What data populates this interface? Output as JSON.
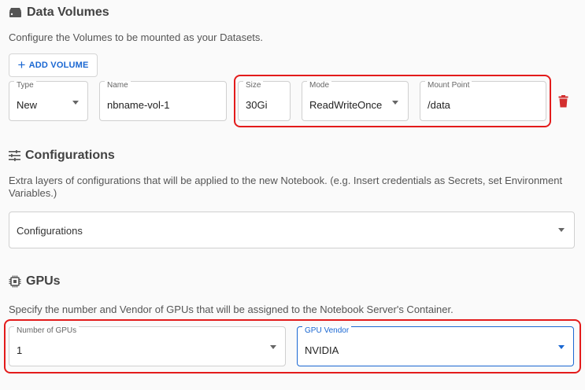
{
  "data_volumes": {
    "title": "Data Volumes",
    "icon": "storage-icon",
    "description": "Configure the Volumes to be mounted as your Datasets.",
    "add_button": {
      "plus": "+",
      "label": "ADD VOLUME"
    },
    "volume": {
      "type": {
        "label": "Type",
        "value": "New"
      },
      "name": {
        "label": "Name",
        "value": "nbname-vol-1"
      },
      "size": {
        "label": "Size",
        "value": "30Gi"
      },
      "mode": {
        "label": "Mode",
        "value": "ReadWriteOnce"
      },
      "mount_point": {
        "label": "Mount Point",
        "value": "/data"
      }
    },
    "delete_icon": "trash-icon"
  },
  "configurations": {
    "title": "Configurations",
    "icon": "tune-icon",
    "description": "Extra layers of configurations that will be applied to the new Notebook. (e.g. Insert credentials as Secrets, set Environment Variables.)",
    "select_placeholder": "Configurations"
  },
  "gpus": {
    "title": "GPUs",
    "icon": "chip-icon",
    "description": "Specify the number and Vendor of GPUs that will be assigned to the Notebook Server's Container.",
    "number": {
      "label": "Number of GPUs",
      "value": "1"
    },
    "vendor": {
      "label": "GPU Vendor",
      "value": "NVIDIA"
    }
  },
  "colors": {
    "accent": "#1a67d2",
    "highlight": "#e31b1b",
    "delete": "#d32f2f"
  }
}
